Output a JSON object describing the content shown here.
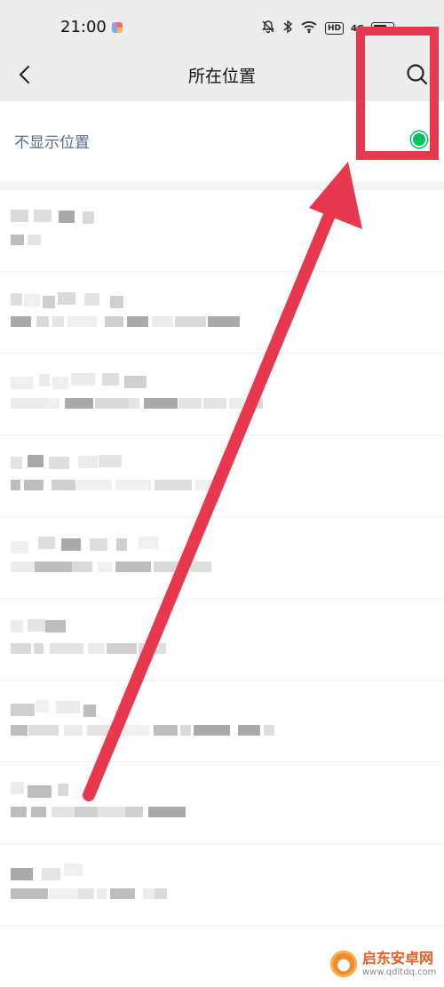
{
  "status_bar": {
    "time": "21:00",
    "icons": [
      "bell-off-icon",
      "bluetooth-icon",
      "wifi-icon",
      "hd-icon",
      "signal-4g-icon",
      "battery-icon"
    ],
    "hd_label": "HD",
    "network_label": "4G"
  },
  "nav": {
    "title": "所在位置",
    "back_icon": "chevron-left-icon",
    "search_icon": "search-icon"
  },
  "options": {
    "no_location_label": "不显示位置",
    "no_location_selected": true
  },
  "colors": {
    "link_blue": "#576b95",
    "selected_green": "#07c160",
    "annotation_red": "#e8384e",
    "header_bg": "#ededed"
  },
  "location_list": {
    "count": 9,
    "content": "pixelated/obscured"
  },
  "watermark": {
    "title": "启东安卓网",
    "url": "www.qdltdq.com"
  }
}
